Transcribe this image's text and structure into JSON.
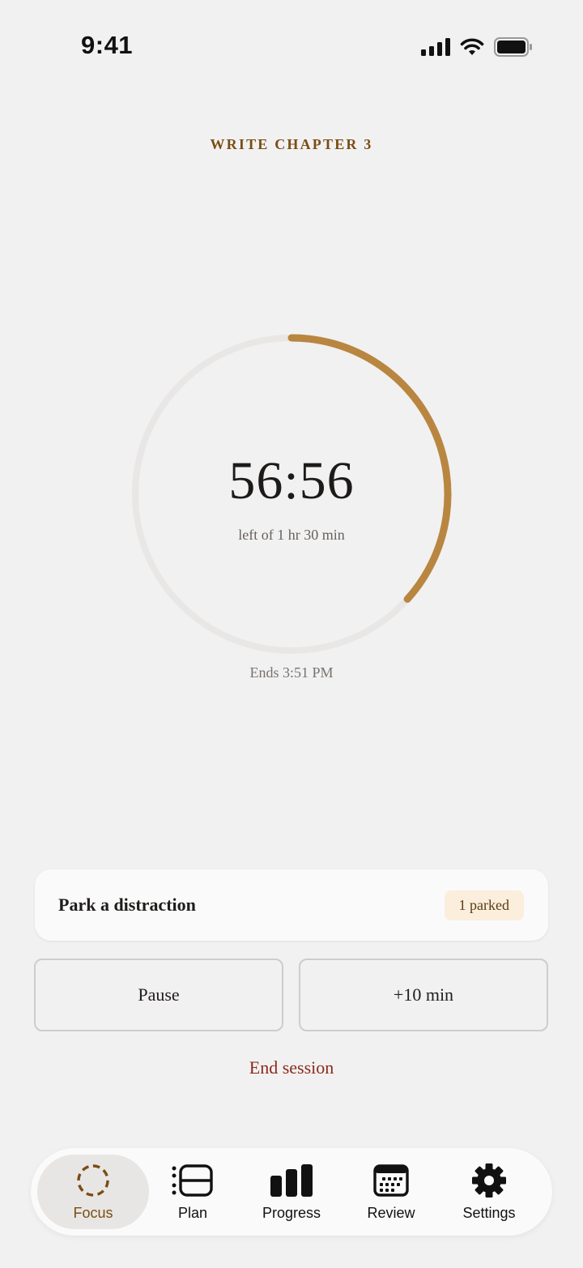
{
  "status_bar": {
    "time": "9:41",
    "icons": [
      "cellular-signal-icon",
      "wifi-icon",
      "battery-icon"
    ]
  },
  "session": {
    "task_title": "WRITE CHAPTER 3",
    "remaining": "56:56",
    "caption": "left of 1 hr 30 min",
    "ends": "Ends 3:51 PM",
    "progress_fraction": 0.367
  },
  "distraction": {
    "label": "Park a distraction",
    "badge": "1 parked"
  },
  "actions": {
    "pause": "Pause",
    "extend": "+10 min",
    "end": "End session"
  },
  "tabs": [
    {
      "label": "Focus",
      "icon": "focus-ring-icon",
      "active": true
    },
    {
      "label": "Plan",
      "icon": "plan-list-icon",
      "active": false
    },
    {
      "label": "Progress",
      "icon": "bar-chart-icon",
      "active": false
    },
    {
      "label": "Review",
      "icon": "calendar-icon",
      "active": false
    },
    {
      "label": "Settings",
      "icon": "gear-icon",
      "active": false
    }
  ],
  "colors": {
    "accent": "#b98641",
    "accent_text": "#7a4d14",
    "danger": "#8a2a1c",
    "background": "#f2f1f1",
    "ring_track": "#e8e7e6"
  }
}
